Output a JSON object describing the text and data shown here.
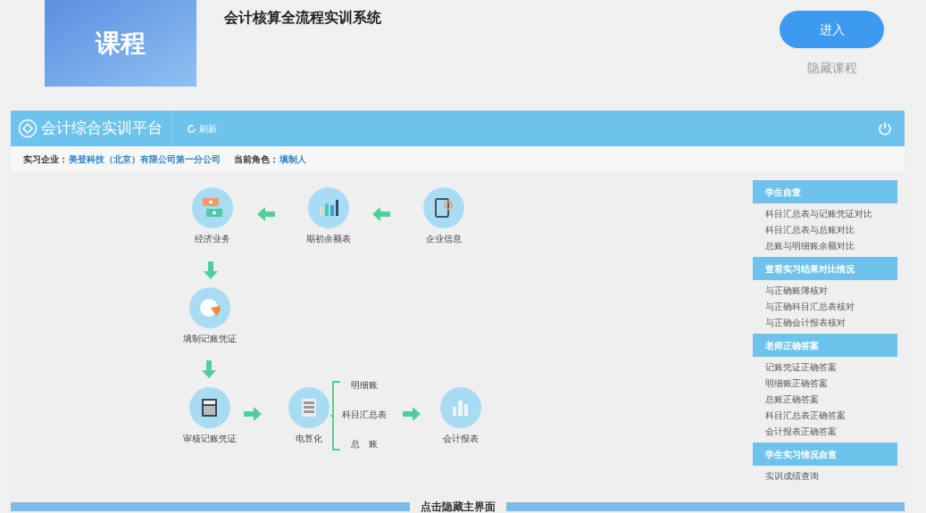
{
  "course": {
    "thumbnail_label": "课程",
    "title": "会计核算全流程实训系统",
    "enter_button": "进入",
    "hide_link": "隐藏课程"
  },
  "platform": {
    "title": "会计综合实训平台",
    "refresh": "刷新",
    "company_label": "实习企业：",
    "company": "美登科技（北京）有限公司第一分公司",
    "role_label": "当前角色：",
    "role": "填制人"
  },
  "flow": {
    "nodes": [
      {
        "label": "经济业务",
        "kind": "money"
      },
      {
        "label": "期初余额表",
        "kind": "bars"
      },
      {
        "label": "企业信息",
        "kind": "tablet"
      },
      {
        "label": "填制记账凭证",
        "kind": "pie"
      },
      {
        "label": "审核记账凭证",
        "kind": "calculator"
      },
      {
        "label": "电算化",
        "kind": "cabinet"
      },
      {
        "label": "会计报表",
        "kind": "report"
      }
    ],
    "ledgers": [
      "明细账",
      "科目汇总表",
      "总　账"
    ]
  },
  "sidebar": [
    {
      "title": "学生自查",
      "items": [
        "科目汇总表与记账凭证对比",
        "科目汇总表与总账对比",
        "总账与明细账余额对比"
      ]
    },
    {
      "title": "查看实习结果对比情况",
      "items": [
        "与正确账簿核对",
        "与正确科目汇总表核对",
        "与正确会计报表核对"
      ]
    },
    {
      "title": "老师正确答案",
      "items": [
        "记账凭证正确答案",
        "明细账正确答案",
        "总账正确答案",
        "科目汇总表正确答案",
        "会计报表正确答案"
      ]
    },
    {
      "title": "学生实习情况自查",
      "items": [
        "实训成绩查询"
      ]
    }
  ],
  "footer": "点击隐藏主界面"
}
